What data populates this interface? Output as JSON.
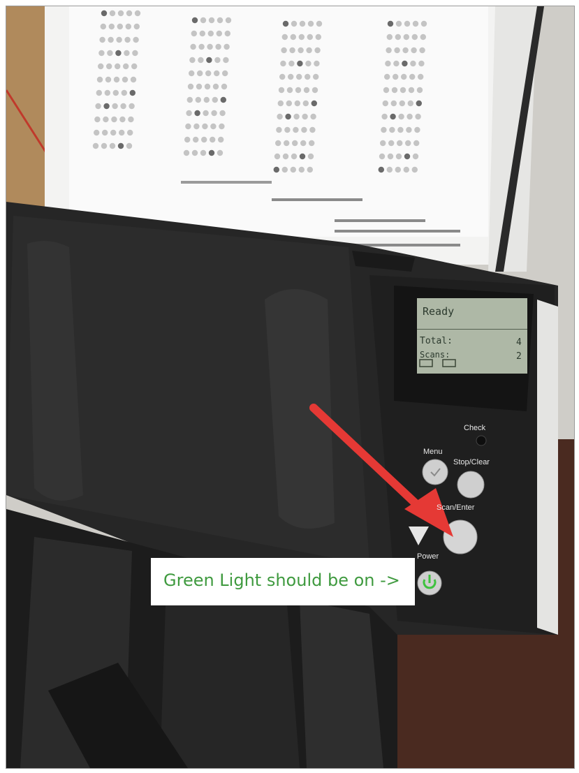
{
  "lcd": {
    "line1": "Ready",
    "line2": "Total:",
    "line3": "Scans:",
    "value1": "4",
    "value2": "2"
  },
  "buttons": {
    "check": "Check",
    "menu": "Menu",
    "stop_clear": "Stop/Clear",
    "scan_enter": "Scan/Enter",
    "power": "Power"
  },
  "callout": {
    "text": "Green Light should be on ->"
  },
  "colors": {
    "arrow": "#e53935",
    "power_light": "#3ec23e",
    "callout_text": "#3f9a3f",
    "scanner_body": "#262626"
  }
}
